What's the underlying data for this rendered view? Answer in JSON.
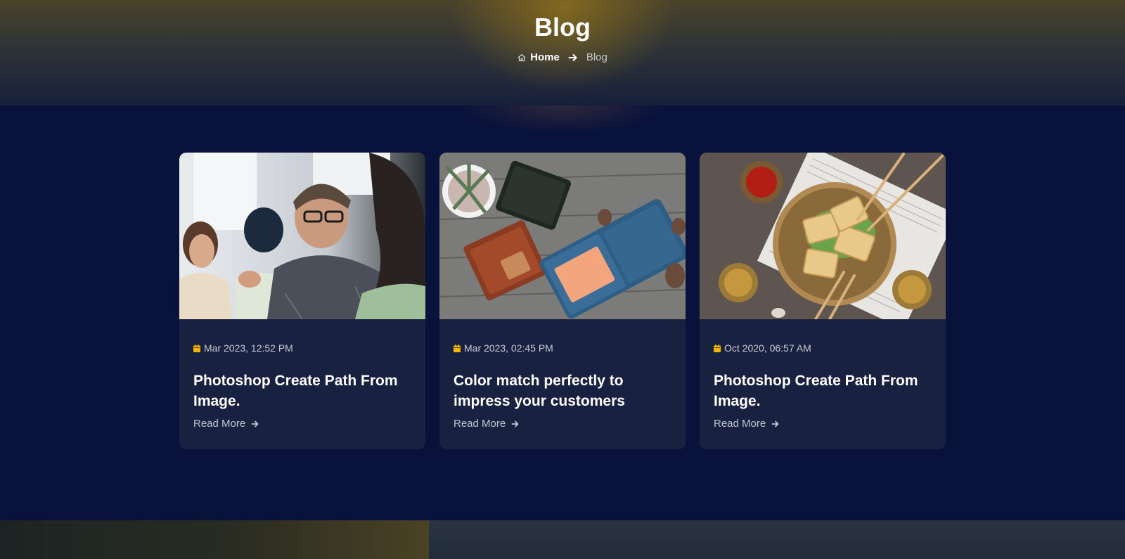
{
  "hero": {
    "title": "Blog",
    "breadcrumb": {
      "home": "Home",
      "current": "Blog"
    }
  },
  "colors": {
    "background": "#08123a",
    "card": "#18213f",
    "accent_date_icon": "#f5b400"
  },
  "icons": {
    "home": "home-icon",
    "arrow": "arrow-right-icon",
    "calendar": "calendar-icon"
  },
  "posts": [
    {
      "date": "Mar 2023, 12:52 PM",
      "title": "Photoshop Create Path From Image.",
      "read_more": "Read More"
    },
    {
      "date": "Mar 2023, 02:45 PM",
      "title": "Color match perfectly to impress your customers",
      "read_more": "Read More"
    },
    {
      "date": "Oct 2020, 06:57 AM",
      "title": "Photoshop Create Path From Image.",
      "read_more": "Read More"
    }
  ]
}
